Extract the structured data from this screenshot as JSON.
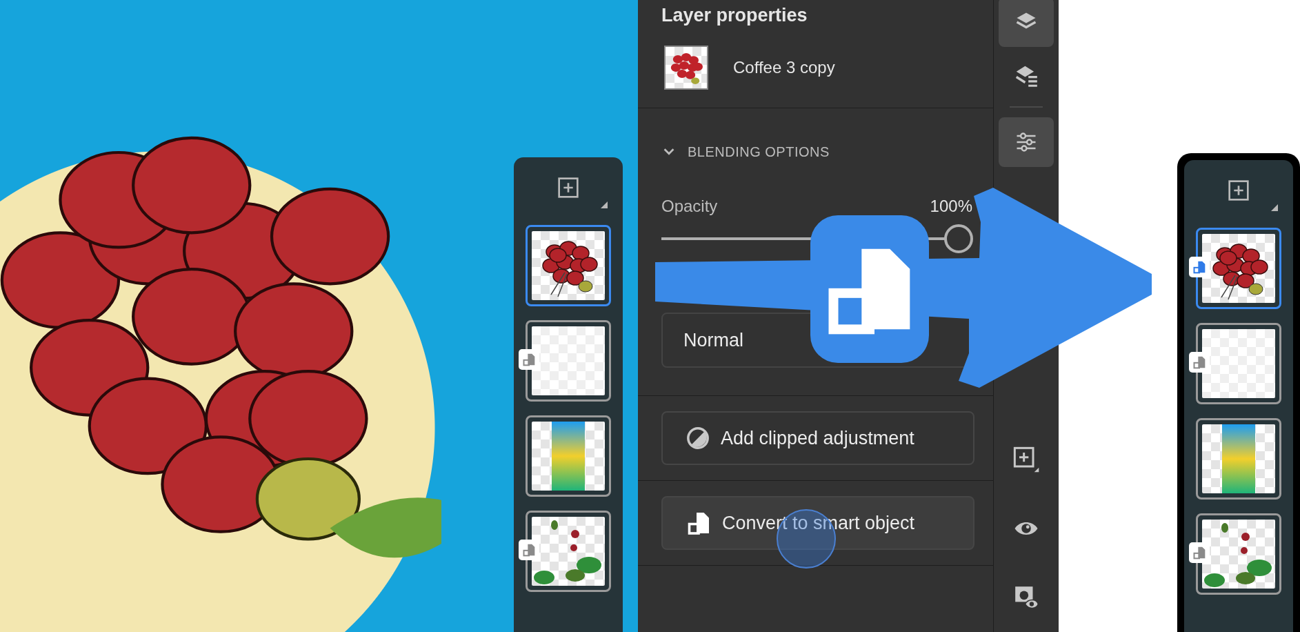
{
  "properties_panel": {
    "title": "Layer properties",
    "layer_name": "Coffee 3 copy",
    "section": {
      "label": "BLENDING OPTIONS",
      "expanded": true
    },
    "opacity": {
      "label": "Opacity",
      "reading": "100%",
      "level": 1
    },
    "blend_mode": {
      "value": "Normal"
    },
    "buttons": [
      {
        "label": "Add clipped adjustment",
        "kind": "adjustment",
        "pressed": false
      },
      {
        "label": "Convert to smart object",
        "kind": "smart",
        "pressed": true
      }
    ]
  },
  "rail": {
    "top": [
      {
        "kind": "layers",
        "selected": true
      },
      {
        "kind": "properties",
        "selected": false
      },
      {
        "kind": "adjustments",
        "selected": true
      }
    ],
    "bottom": [
      {
        "kind": "add"
      },
      {
        "kind": "visibility"
      },
      {
        "kind": "mask"
      }
    ]
  },
  "layer_strips": [
    {
      "layers": [
        {
          "kind": "coffee",
          "selected": true,
          "smart_object": false
        },
        {
          "kind": "texture",
          "selected": false,
          "smart_object": true
        },
        {
          "kind": "gradient",
          "selected": false,
          "smart_object": false
        },
        {
          "kind": "plants",
          "selected": false,
          "smart_object": true
        }
      ]
    },
    {
      "layers": [
        {
          "kind": "coffee",
          "selected": true,
          "smart_object": true
        },
        {
          "kind": "texture",
          "selected": false,
          "smart_object": true
        },
        {
          "kind": "gradient",
          "selected": false,
          "smart_object": false
        },
        {
          "kind": "plants",
          "selected": false,
          "smart_object": true
        }
      ]
    }
  ]
}
